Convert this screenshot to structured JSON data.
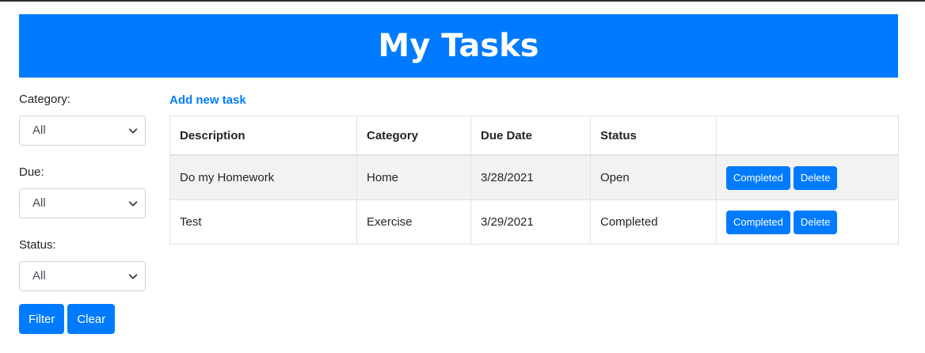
{
  "header": {
    "title": "My Tasks"
  },
  "filters": {
    "category": {
      "label": "Category:",
      "value": "All"
    },
    "due": {
      "label": "Due:",
      "value": "All"
    },
    "status": {
      "label": "Status:",
      "value": "All"
    },
    "filter_button": "Filter",
    "clear_button": "Clear"
  },
  "main": {
    "add_link": "Add new task",
    "columns": [
      "Description",
      "Category",
      "Due Date",
      "Status",
      ""
    ],
    "rows": [
      {
        "description": "Do my Homework",
        "category": "Home",
        "due_date": "3/28/2021",
        "status": "Open",
        "completed_button": "Completed",
        "delete_button": "Delete"
      },
      {
        "description": "Test",
        "category": "Exercise",
        "due_date": "3/29/2021",
        "status": "Completed",
        "completed_button": "Completed",
        "delete_button": "Delete"
      }
    ]
  },
  "colors": {
    "primary": "#007bff",
    "stripe": "#f2f2f2",
    "border": "#dee2e6"
  },
  "icons": {
    "select_arrow": "chevron-down-icon"
  }
}
